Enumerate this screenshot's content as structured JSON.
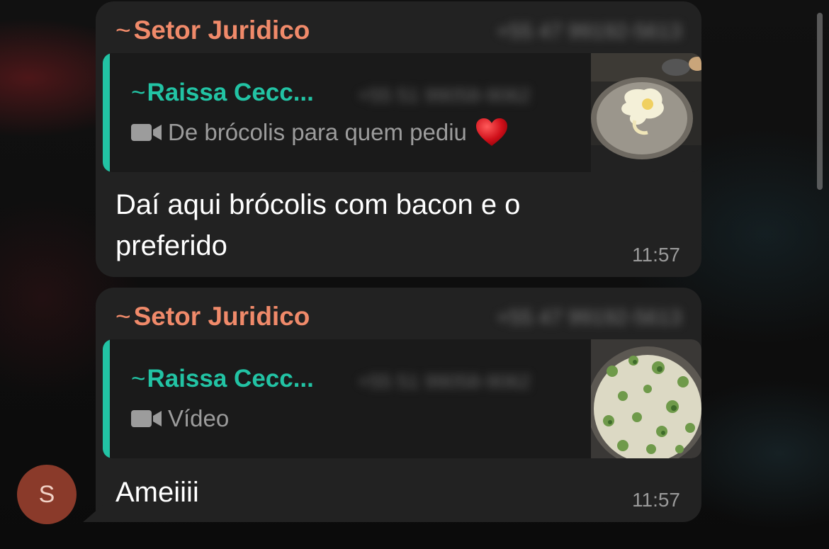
{
  "messages": [
    {
      "sender": {
        "tilde": "~",
        "name": "Setor Juridico",
        "phone": "+55 47 99192-5613"
      },
      "quote": {
        "tilde": "~",
        "name": "Raissa Cecc...",
        "phone": "+55 51 99058-9062",
        "media_icon": "video-icon",
        "caption": "De brócolis para quem pediu",
        "emoji": "heart-icon",
        "thumbnail": "pan-with-cheese-thumbnail"
      },
      "text": "Daí aqui brócolis com bacon e o preferido",
      "time": "11:57"
    },
    {
      "sender": {
        "tilde": "~",
        "name": "Setor Juridico",
        "phone": "+55 47 99192-5613"
      },
      "quote": {
        "tilde": "~",
        "name": "Raissa Cecc...",
        "phone": "+55 51 99058-9062",
        "media_icon": "video-icon",
        "caption": "Vídeo",
        "thumbnail": "broccoli-dish-thumbnail"
      },
      "text": "Ameiiii",
      "time": "11:57"
    }
  ],
  "avatar": {
    "initial": "S",
    "color": "#8a3a2a"
  },
  "colors": {
    "sender_name": "#f08a6a",
    "quote_accent": "#22c3a4",
    "bubble": "#222222",
    "heart": "#d0101a"
  }
}
